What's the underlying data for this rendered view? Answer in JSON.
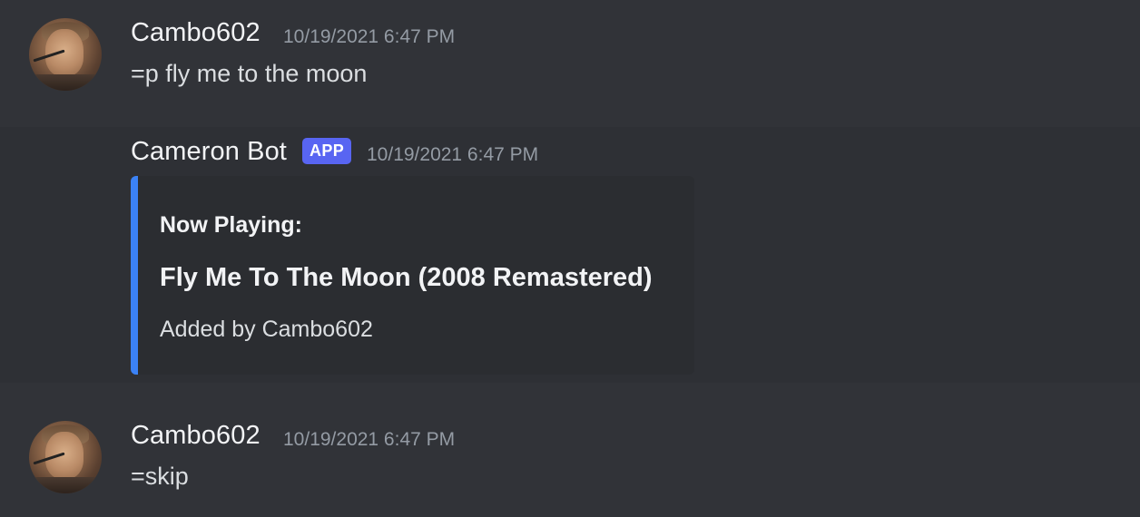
{
  "messages": [
    {
      "author": "Cambo602",
      "timestamp": "10/19/2021 6:47 PM",
      "content": "=p fly me to the moon"
    },
    {
      "author": "Cameron Bot",
      "badge": "APP",
      "timestamp": "10/19/2021 6:47 PM",
      "embed": {
        "author": "Now Playing:",
        "title": "Fly Me To The Moon (2008 Remastered)",
        "description": "Added by Cambo602",
        "accent_color": "#3b82f6"
      }
    },
    {
      "author": "Cambo602",
      "timestamp": "10/19/2021 6:47 PM",
      "content": "=skip"
    }
  ],
  "colors": {
    "background": "#313338",
    "hover_background": "#2e3035",
    "embed_background": "#2b2d31",
    "badge": "#5865f2",
    "username": "#f2f3f5",
    "timestamp": "#949ba4",
    "text": "#dbdee1"
  },
  "icons": {
    "avatar": "user-avatar-photo"
  }
}
